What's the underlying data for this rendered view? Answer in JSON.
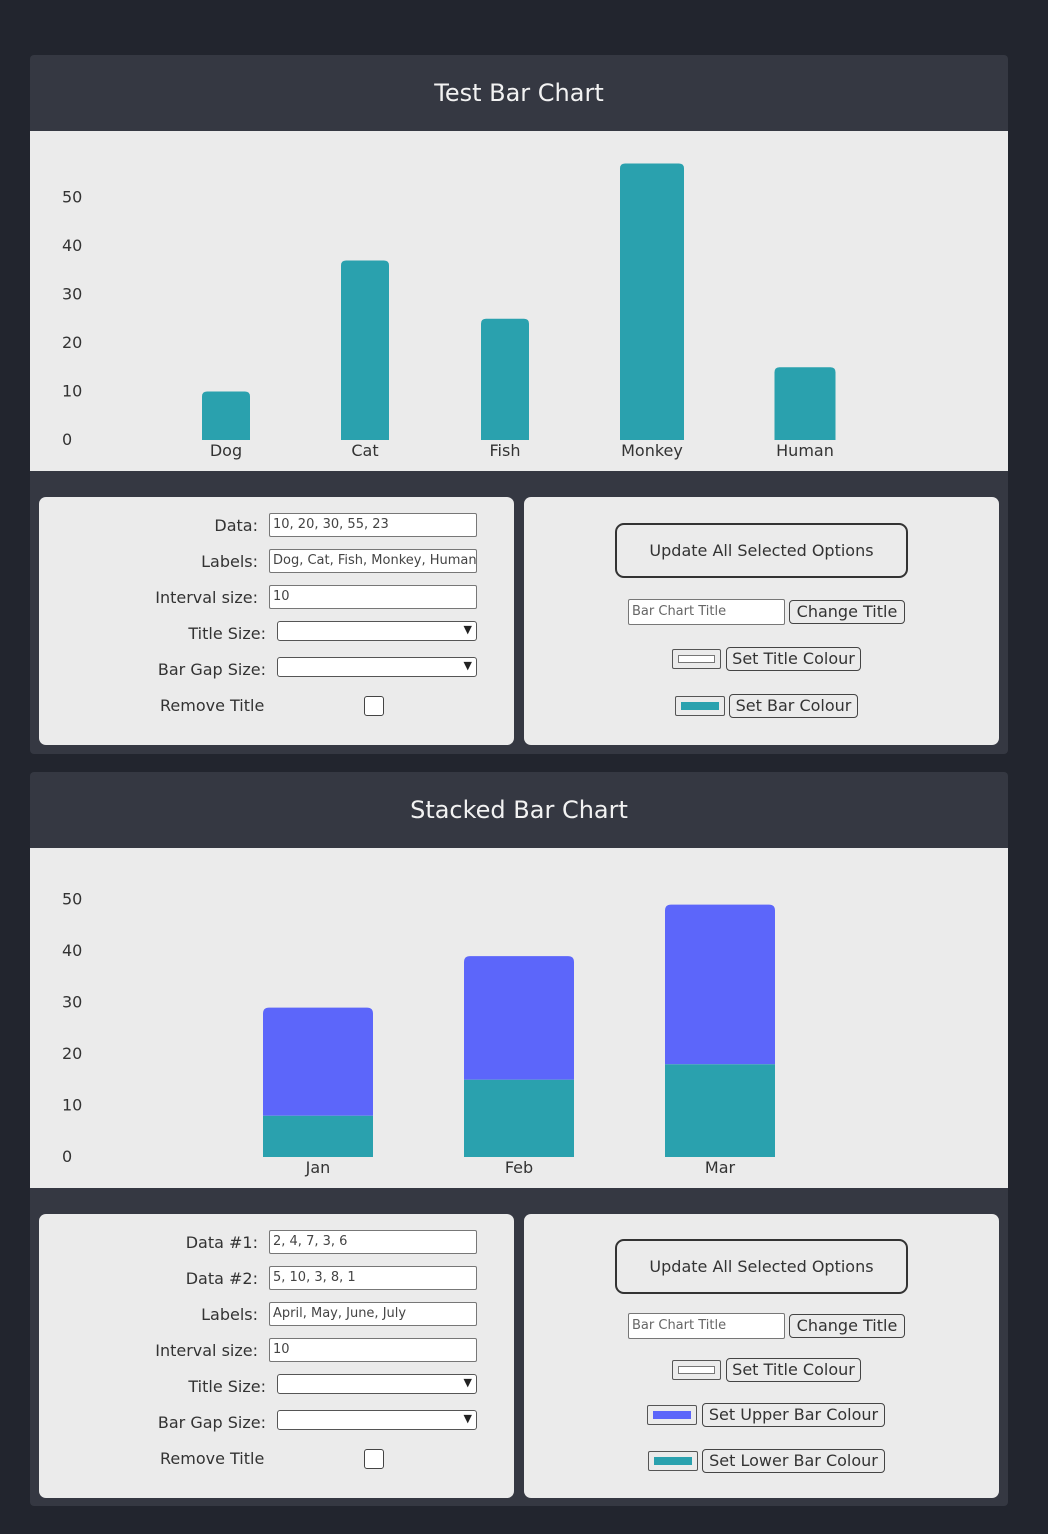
{
  "chart1": {
    "title": "Test Bar Chart",
    "chart_data": {
      "type": "bar",
      "categories": [
        "Dog",
        "Cat",
        "Fish",
        "Monkey",
        "Human"
      ],
      "values": [
        10,
        37,
        25,
        57,
        15
      ],
      "yticks": [
        0,
        10,
        20,
        30,
        40,
        50
      ],
      "ylim": [
        0,
        57
      ],
      "bar_color": "#2aa1ae"
    },
    "controls": {
      "data_label": "Data:",
      "data_value": "10, 20, 30, 55, 23",
      "labels_label": "Labels:",
      "labels_value": "Dog, Cat, Fish, Monkey, Human",
      "interval_label": "Interval size:",
      "interval_value": "10",
      "title_size_label": "Title Size:",
      "bar_gap_label": "Bar Gap Size:",
      "remove_title_label": "Remove Title"
    },
    "options": {
      "update_label": "Update All Selected Options",
      "title_placeholder": "Bar Chart Title",
      "change_title_label": "Change Title",
      "title_colour_label": "Set Title Colour",
      "title_colour": "#ffffff",
      "bar_colour_label": "Set Bar Colour",
      "bar_colour": "#2aa1ae"
    }
  },
  "chart2": {
    "title": "Stacked Bar Chart",
    "chart_data": {
      "type": "bar",
      "stacked": true,
      "categories": [
        "Jan",
        "Feb",
        "Mar"
      ],
      "series": [
        {
          "values": [
            8,
            15,
            18
          ],
          "color": "#2aa1ae"
        },
        {
          "values": [
            21,
            24,
            31
          ],
          "color": "#5c66fa"
        }
      ],
      "yticks": [
        0,
        10,
        20,
        30,
        40,
        50
      ],
      "ylim": [
        0,
        50
      ]
    },
    "controls": {
      "data1_label": "Data #1:",
      "data1_value": "2, 4, 7, 3, 6",
      "data2_label": "Data #2:",
      "data2_value": "5, 10, 3, 8, 1",
      "labels_label": "Labels:",
      "labels_value": "April, May, June, July",
      "interval_label": "Interval size:",
      "interval_value": "10",
      "title_size_label": "Title Size:",
      "bar_gap_label": "Bar Gap Size:",
      "remove_title_label": "Remove Title"
    },
    "options": {
      "update_label": "Update All Selected Options",
      "title_placeholder": "Bar Chart Title",
      "change_title_label": "Change Title",
      "title_colour_label": "Set Title Colour",
      "title_colour": "#ffffff",
      "upper_colour_label": "Set Upper Bar Colour",
      "upper_colour": "#5c66fa",
      "lower_colour_label": "Set Lower Bar Colour",
      "lower_colour": "#2aa1ae"
    }
  }
}
